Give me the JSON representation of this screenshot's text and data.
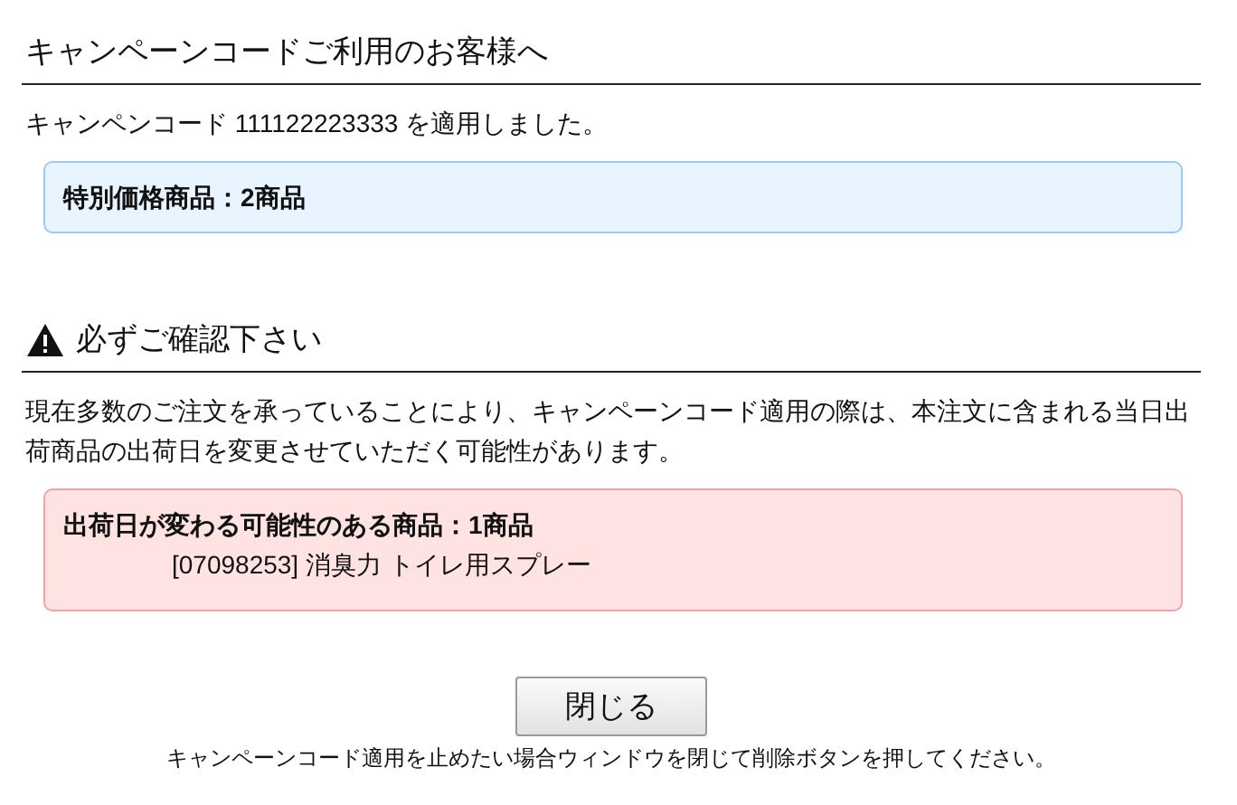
{
  "campaign": {
    "title": "キャンペーンコードご利用のお客様へ",
    "message": "キャンペンコード 111122223333 を適用しました。",
    "notice": "特別価格商品：2商品"
  },
  "warning": {
    "title": "必ずご確認下さい",
    "message": "現在多数のご注文を承っていることにより、キャンペーンコード適用の際は、本注文に含まれる当日出荷商品の出荷日を変更させていただく可能性があります。",
    "notice": "出荷日が変わる可能性のある商品：1商品",
    "items": [
      "[07098253] 消臭力 トイレ用スプレー"
    ]
  },
  "close_button": "閉じる",
  "footnote": "キャンペーンコード適用を止めたい場合ウィンドウを閉じて削除ボタンを押してください。"
}
